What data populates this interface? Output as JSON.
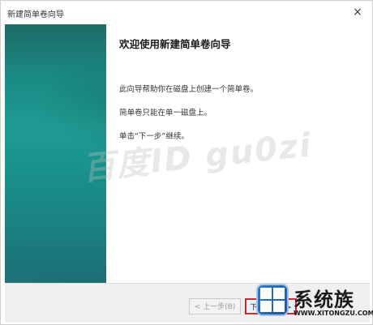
{
  "window": {
    "title": "新建简单卷向导",
    "close_glyph": "×"
  },
  "content": {
    "heading": "欢迎使用新建简单卷向导",
    "paragraphs": [
      "此向导帮助你在磁盘上创建一个简单卷。",
      "简单卷只能在单一磁盘上。",
      "单击“下一步”继续。"
    ]
  },
  "footer": {
    "back_label": "< 上一步(B)",
    "next_label": "下一步(N) >"
  },
  "watermark": {
    "text": "百度ID  gu0zi"
  },
  "logo": {
    "name": "系统族",
    "url": "WWW.XITONGZU.COM"
  },
  "colors": {
    "side_panel": "#1a8a84",
    "highlight_border": "#d9232d",
    "logo_blue": "#1452a8"
  },
  "icons": [
    "close-icon",
    "windows-logo-icon"
  ]
}
